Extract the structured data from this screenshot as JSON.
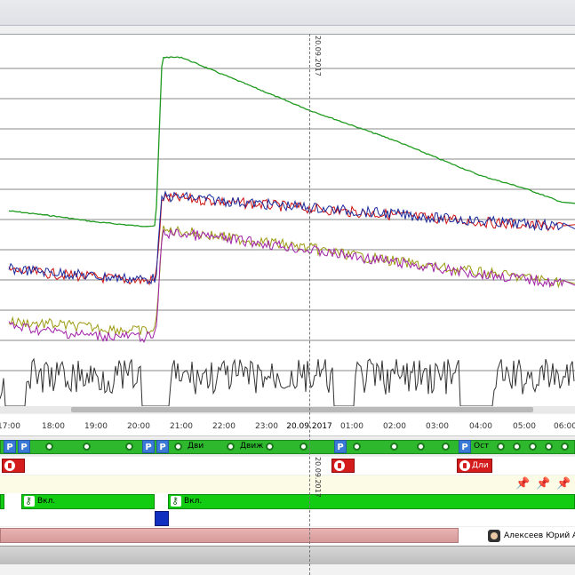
{
  "timeline": {
    "date_marker": "20.09.2017",
    "ticks": [
      "17:00",
      "18:00",
      "19:00",
      "20:00",
      "21:00",
      "22:00",
      "23:00",
      "20.09.2017",
      "01:00",
      "02:00",
      "03:00",
      "04:00",
      "05:00",
      "06:00"
    ]
  },
  "events": {
    "labels": {
      "p": "P",
      "dvi": "Дви",
      "dvizh": "Движ",
      "ost": "Ост"
    }
  },
  "alarms": {
    "dli": "Дли"
  },
  "ignition": {
    "label1": "Вкл.",
    "label2": "Вкл."
  },
  "driver": {
    "name": "Алексеев Юрий А"
  },
  "colors": {
    "green_series": "#1e9a1e",
    "red_series": "#cc1010",
    "blue_series": "#1a2a9c",
    "olive_series": "#9c9a10",
    "magenta_series": "#a020a8",
    "dark_series": "#333333",
    "event_green": "#2db82d",
    "ignition_green": "#11cc11",
    "alarm_red": "#d41c1c",
    "parking_blue": "#3a7ad6"
  },
  "chart_data": {
    "type": "line",
    "title": "",
    "x": [
      "17:00",
      "18:00",
      "19:00",
      "20:00",
      "21:00",
      "22:00",
      "23:00",
      "00:00",
      "01:00",
      "02:00",
      "03:00",
      "04:00",
      "05:00",
      "06:00"
    ],
    "series": [
      {
        "color_key": "green_series",
        "values": [
          250,
          240,
          228,
          220,
          555,
          520,
          485,
          450,
          420,
          390,
          355,
          320,
          295,
          265
        ]
      },
      {
        "color_key": "red_series",
        "values": [
          132,
          125,
          118,
          112,
          275,
          268,
          262,
          255,
          248,
          242,
          235,
          228,
          222,
          218
        ]
      },
      {
        "color_key": "blue_series",
        "values": [
          135,
          128,
          120,
          115,
          278,
          270,
          263,
          257,
          250,
          244,
          236,
          230,
          224,
          220
        ]
      },
      {
        "color_key": "olive_series",
        "values": [
          30,
          25,
          18,
          12,
          210,
          198,
          188,
          176,
          162,
          150,
          138,
          128,
          118,
          108
        ]
      },
      {
        "color_key": "magenta_series",
        "values": [
          22,
          10,
          2,
          0,
          205,
          195,
          185,
          172,
          160,
          148,
          135,
          125,
          115,
          105
        ]
      }
    ],
    "grid": true
  }
}
